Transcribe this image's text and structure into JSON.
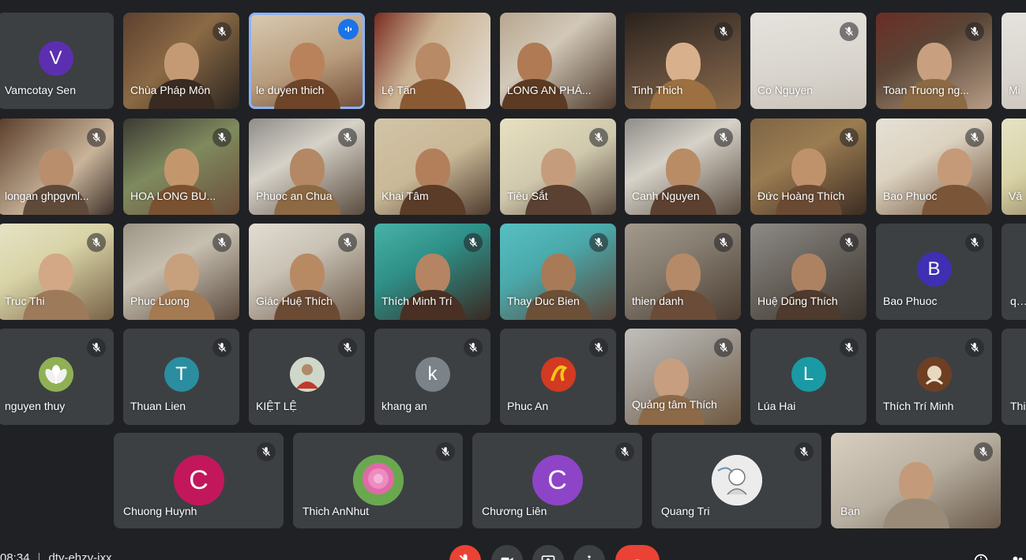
{
  "meeting": {
    "time": "08:34",
    "code": "dty-ehzy-jxx"
  },
  "colors": {
    "background": "#202124",
    "tile": "#3c4043",
    "speaking_outline": "#8ab4f8",
    "leave_button": "#ea4335"
  },
  "participants": [
    {
      "name": "Vamcotay Sen",
      "avatar_letter": "V",
      "avatar_color": "#5b2fb0"
    },
    {
      "name": "Chùa Pháp Môn",
      "video": true
    },
    {
      "name": "le duyen thich",
      "video": true,
      "speaking": true
    },
    {
      "name": "Lệ Tấn",
      "video": true
    },
    {
      "name": "LONG AN PHÁ...",
      "video": true
    },
    {
      "name": "Tinh Thich",
      "video": true
    },
    {
      "name": "Co Nguyen",
      "video": true
    },
    {
      "name": "Toan Truong ng...",
      "video": true
    },
    {
      "name": "Mi",
      "video": true
    },
    {
      "name": "longan ghpgvnl...",
      "video": true
    },
    {
      "name": "HOA LONG BU...",
      "video": true
    },
    {
      "name": "Phuoc an Chua",
      "video": true
    },
    {
      "name": "Khai Tâm",
      "video": true
    },
    {
      "name": "Tiêu Sắt",
      "video": true
    },
    {
      "name": "Canh Nguyen",
      "video": true
    },
    {
      "name": "Đức Hoàng Thích",
      "video": true
    },
    {
      "name": "Bao Phuoc",
      "video": true
    },
    {
      "name": "Vă",
      "video": true
    },
    {
      "name": "Truc Thi",
      "video": true
    },
    {
      "name": "Phuc Luong",
      "video": true
    },
    {
      "name": "Giác Huệ Thích",
      "video": true
    },
    {
      "name": "Thích Minh Trí",
      "video": true
    },
    {
      "name": "Thay Duc Bien",
      "video": true
    },
    {
      "name": "thien danh",
      "video": true
    },
    {
      "name": "Huệ Dũng Thích",
      "video": true
    },
    {
      "name": "Bao Phuoc",
      "avatar_letter": "B",
      "avatar_color": "#3f2fb3"
    },
    {
      "name": "qua",
      "avatar_letter": ""
    },
    {
      "name": "nguyen thuy",
      "avatar_image": "lotus"
    },
    {
      "name": "Thuan Lien",
      "avatar_letter": "T",
      "avatar_color": "#2a8ea0"
    },
    {
      "name": "KIỆT LỆ",
      "avatar_image": "photo"
    },
    {
      "name": "khang an",
      "avatar_letter": "k",
      "avatar_color": "#7b8388"
    },
    {
      "name": "Phuc An",
      "avatar_image": "calligraphy"
    },
    {
      "name": "Quảng tâm Thích",
      "video": true
    },
    {
      "name": "Lúa Hai",
      "avatar_letter": "L",
      "avatar_color": "#1a9aa5"
    },
    {
      "name": "Thích Trí Minh",
      "avatar_image": "photo"
    },
    {
      "name": "Thi",
      "avatar_letter": ""
    },
    {
      "name": "Chuong Huynh",
      "avatar_letter": "C",
      "avatar_color": "#c2185b"
    },
    {
      "name": "Thich AnNhut",
      "avatar_image": "peony"
    },
    {
      "name": "Chương Liên",
      "avatar_letter": "C",
      "avatar_color": "#8e44c7"
    },
    {
      "name": "Quang Tri",
      "avatar_image": "drawing"
    },
    {
      "name": "Bạn",
      "video": true,
      "self": true
    }
  ]
}
